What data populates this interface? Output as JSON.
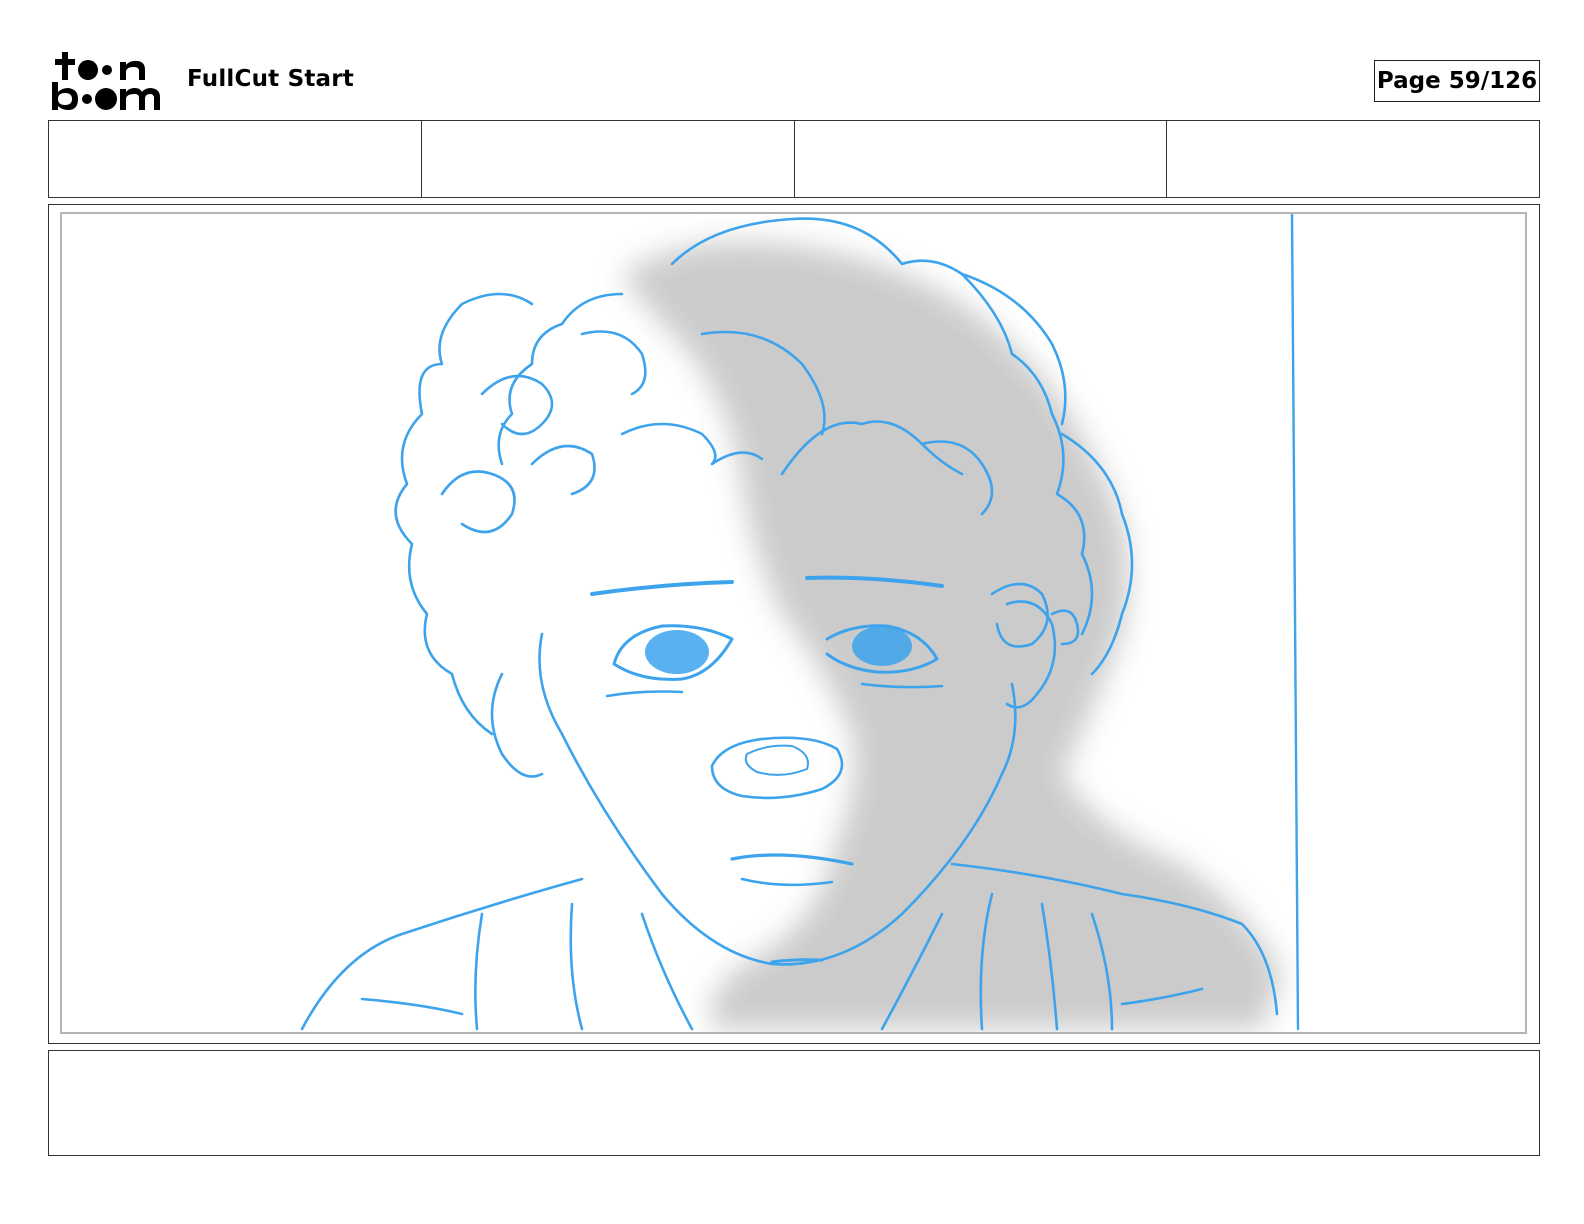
{
  "header": {
    "logo_lines": [
      "toon",
      "boom"
    ],
    "project_title": "FullCut Start",
    "page_label": "Page",
    "page_number": "59/126"
  },
  "info_cells": [
    "",
    "",
    "",
    ""
  ],
  "panel": {
    "sketch_color": "#3da3ec",
    "shadow_color": "#c9c9c9"
  },
  "notes": ""
}
